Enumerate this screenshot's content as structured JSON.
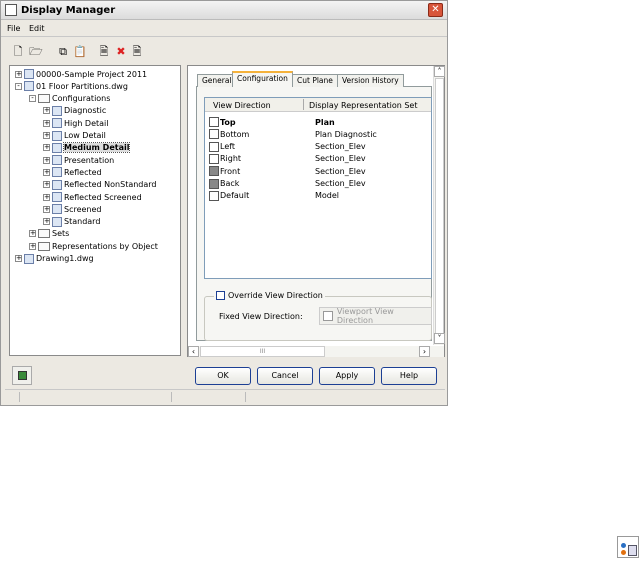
{
  "window": {
    "title": "Display Manager"
  },
  "menu": [
    "File",
    "Edit"
  ],
  "tree": [
    {
      "label": "00000-Sample Project 2011",
      "level": 0,
      "exp": "+"
    },
    {
      "label": "01 Floor Partitions.dwg",
      "level": 0,
      "exp": "-"
    },
    {
      "label": "Configurations",
      "level": 1,
      "exp": "-"
    },
    {
      "label": "Diagnostic",
      "level": 2,
      "exp": "+"
    },
    {
      "label": "High Detail",
      "level": 2,
      "exp": "+"
    },
    {
      "label": "Low Detail",
      "level": 2,
      "exp": "+"
    },
    {
      "label": "Medium Detail",
      "level": 2,
      "exp": "+",
      "selected": true
    },
    {
      "label": "Presentation",
      "level": 2,
      "exp": "+"
    },
    {
      "label": "Reflected",
      "level": 2,
      "exp": "+"
    },
    {
      "label": "Reflected NonStandard",
      "level": 2,
      "exp": "+"
    },
    {
      "label": "Reflected Screened",
      "level": 2,
      "exp": "+"
    },
    {
      "label": "Screened",
      "level": 2,
      "exp": "+"
    },
    {
      "label": "Standard",
      "level": 2,
      "exp": "+"
    },
    {
      "label": "Sets",
      "level": 1,
      "exp": "+"
    },
    {
      "label": "Representations by Object",
      "level": 1,
      "exp": "+"
    },
    {
      "label": "Drawing1.dwg",
      "level": 0,
      "exp": "+"
    }
  ],
  "tabs": [
    "General",
    "Configuration",
    "Cut Plane",
    "Version History"
  ],
  "list": {
    "headers": [
      "View Direction",
      "Display Representation Set"
    ],
    "rows": [
      [
        "Top",
        "Plan"
      ],
      [
        "Bottom",
        "Plan Diagnostic"
      ],
      [
        "Left",
        "Section_Elev"
      ],
      [
        "Right",
        "Section_Elev"
      ],
      [
        "Front",
        "Section_Elev"
      ],
      [
        "Back",
        "Section_Elev"
      ],
      [
        "Default",
        "Model"
      ]
    ]
  },
  "override": {
    "label": "Override View Direction",
    "checked": false,
    "fixed_label": "Fixed View Direction:",
    "button": "Viewport View Direction"
  },
  "buttons": {
    "ok": "OK",
    "cancel": "Cancel",
    "apply": "Apply",
    "help": "Help"
  },
  "hscroll_grip": "III"
}
